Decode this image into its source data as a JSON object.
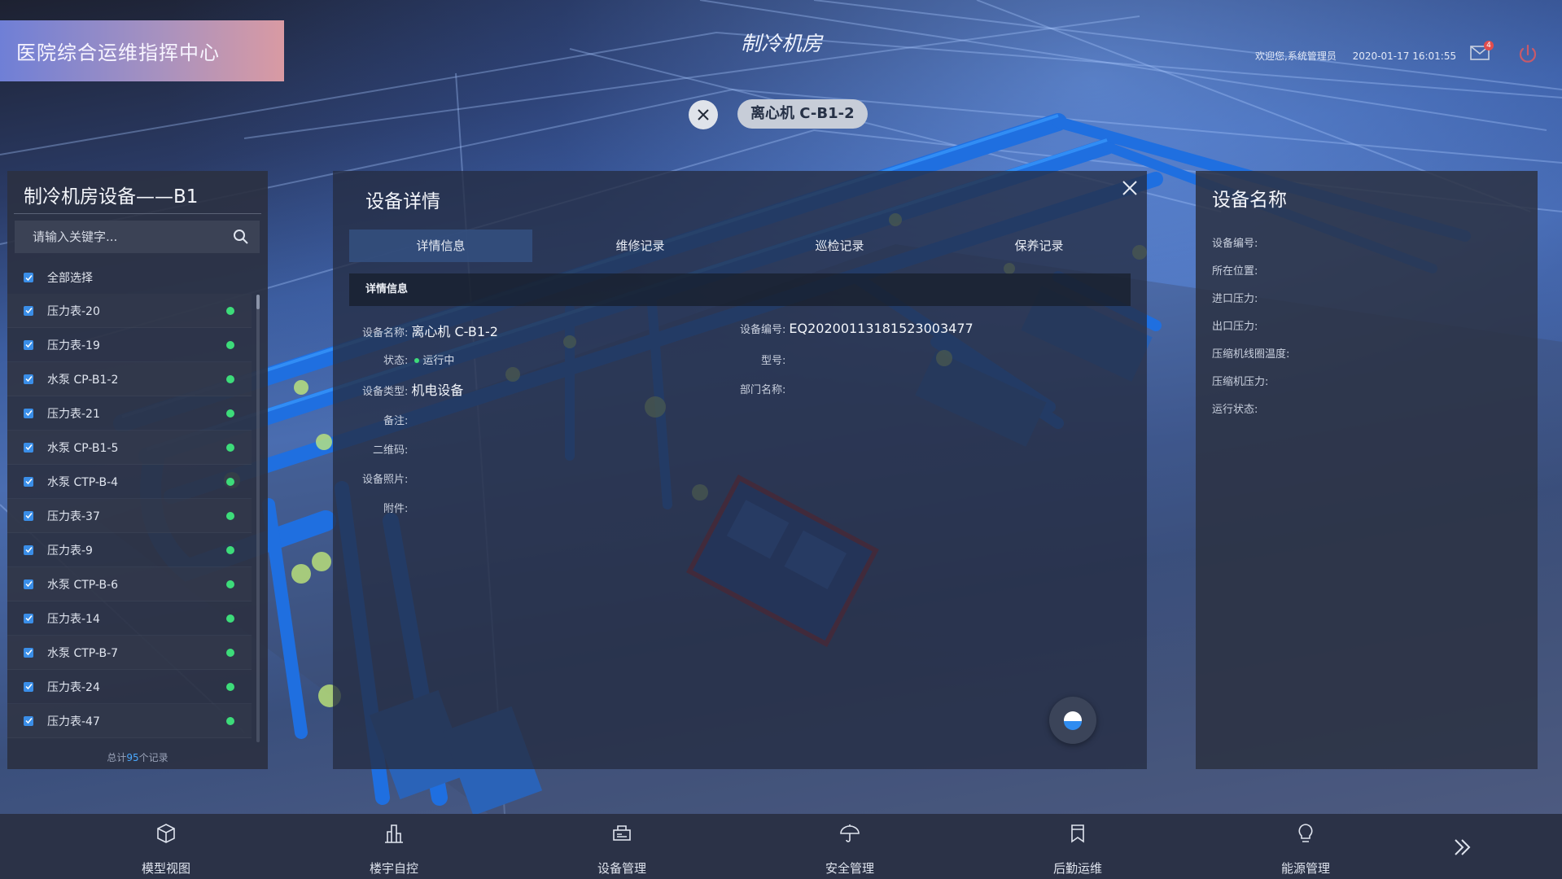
{
  "header": {
    "brand": "医院综合运维指挥中心",
    "room_title": "制冷机房",
    "welcome": "欢迎您,系统管理员",
    "datetime": "2020-01-17 16:01:55",
    "mail_badge": "4"
  },
  "selected_chip": {
    "label": "离心机 C-B1-2"
  },
  "left_panel": {
    "title": "制冷机房设备——B1",
    "search_placeholder": "请输入关键字...",
    "select_all": "全部选择",
    "items": [
      "压力表-20",
      "压力表-19",
      "水泵 CP-B1-2",
      "压力表-21",
      "水泵 CP-B1-5",
      "水泵 CTP-B-4",
      "压力表-37",
      "压力表-9",
      "水泵 CTP-B-6",
      "压力表-14",
      "水泵 CTP-B-7",
      "压力表-24",
      "压力表-47"
    ],
    "total_prefix": "总计",
    "total_count": "95",
    "total_suffix": "个记录"
  },
  "detail": {
    "title": "设备详情",
    "tabs": [
      "详情信息",
      "维修记录",
      "巡检记录",
      "保养记录"
    ],
    "section": "详情信息",
    "fields": {
      "name_label": "设备名称:",
      "name_value": "离心机 C-B1-2",
      "status_label": "状态:",
      "status_value": "运行中",
      "type_label": "设备类型:",
      "type_value": "机电设备",
      "remark_label": "备注:",
      "qrcode_label": "二维码:",
      "photo_label": "设备照片:",
      "attach_label": "附件:",
      "code_label": "设备编号:",
      "code_value": "EQ20200113181523003477",
      "model_label": "型号:",
      "dept_label": "部门名称:"
    }
  },
  "right_panel": {
    "title": "设备名称",
    "fields": [
      "设备编号:",
      "所在位置:",
      "进口压力:",
      "出口压力:",
      "压缩机线圈温度:",
      "压缩机压力:",
      "运行状态:"
    ]
  },
  "bottom_nav": [
    "模型视图",
    "楼宇自控",
    "设备管理",
    "安全管理",
    "后勤运维",
    "能源管理"
  ],
  "colors": {
    "accent": "#3a8ee8",
    "status_ok": "#3ddc7a",
    "panel_bg": "#2b3142"
  }
}
